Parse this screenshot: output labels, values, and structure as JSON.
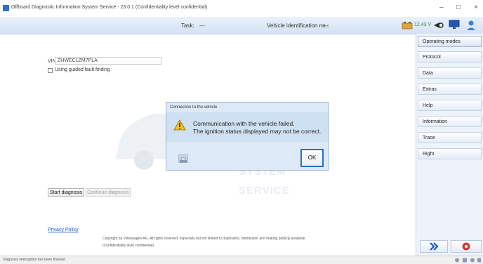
{
  "window": {
    "title": "Offboard Diagnostic Information System Service - 23.0.1 (Confidentiality level confidential)",
    "minimize": "–",
    "maximize": "□",
    "close": "×"
  },
  "header": {
    "task_label": "Task:",
    "task_value": "---",
    "vin_label": "Vehicle identification no.:",
    "vin_value": "---",
    "voltage": "12.43 V"
  },
  "sidebar": {
    "items": [
      {
        "label": "Operating modes"
      },
      {
        "label": "Protocol"
      },
      {
        "label": "Data"
      },
      {
        "label": "Extras"
      },
      {
        "label": "Help"
      },
      {
        "label": "Information"
      },
      {
        "label": "Trace"
      },
      {
        "label": "Right"
      }
    ]
  },
  "main": {
    "vin_label": "VIN",
    "vin_value": "ZHWEC1ZM7PLA",
    "guided_label": "Using guided fault finding",
    "start_label": "Start diagnosis",
    "continue_label": "Continue diagnosis",
    "privacy_label": "Privacy Policy",
    "copyright": "Copyright by Volkswagen AG. All rights reserved, especially but not limited to duplication, distribution and making publicly available.",
    "confidential": "(Confidentiality level confidential)",
    "watermark_line1": "SYSTEM",
    "watermark_line2": "SERVICE"
  },
  "dialog": {
    "title": "Connection to the vehicle",
    "message_line1": "Communication with the vehicle failed.",
    "message_line2": "The ignition status displayed may not be correct.",
    "ok_label": "OK"
  },
  "status": {
    "text": "Diagnosis interruption has been finished"
  },
  "colors": {
    "accent": "#2d6ec4",
    "dialog_bg": "#dde9f6",
    "voltage_green": "#3a8a3a",
    "stop_red": "#d23a2a"
  },
  "icons": {
    "app": "odis-app-icon",
    "battery": "battery-icon",
    "connection": "vci-connection-icon",
    "monitor": "monitor-icon",
    "user": "user-icon",
    "warning": "warning-icon",
    "print": "print-icon",
    "forward": "double-chevron-right-icon",
    "stop": "stop-icon"
  }
}
